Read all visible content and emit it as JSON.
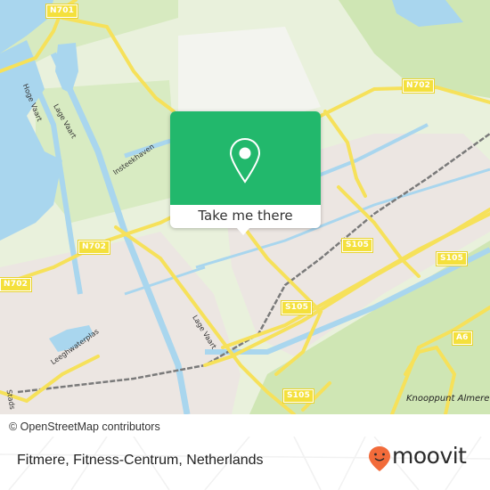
{
  "map": {
    "colors": {
      "water": "#a9d6ee",
      "park": "#cfe6b4",
      "urban": "#ece6e2",
      "road_major": "#f6e15a",
      "railway": "#7a7a7a",
      "background": "#eef3e4"
    },
    "road_shields": [
      {
        "id": "n701",
        "label": "N701"
      },
      {
        "id": "n702-east",
        "label": "N702"
      },
      {
        "id": "n702-center",
        "label": "N702"
      },
      {
        "id": "n702-west",
        "label": "N702"
      },
      {
        "id": "s105-north",
        "label": "S105"
      },
      {
        "id": "s105-east",
        "label": "S105"
      },
      {
        "id": "s105-center",
        "label": "S105"
      },
      {
        "id": "s105-south",
        "label": "S105"
      },
      {
        "id": "a6",
        "label": "A6"
      }
    ],
    "street_labels": {
      "hoge_vaart": "Hoge Vaart",
      "lage_vaart_north": "Lage Vaart",
      "lage_vaart_center": "Lage Vaart",
      "insteekhaven": "Insteekhaven",
      "leeghwaterplas": "Leeghwaterplas",
      "stadsweg": "Stads"
    },
    "place_labels": {
      "knooppunt": "Knooppunt Almere"
    },
    "attribution": "© OpenStreetMap contributors"
  },
  "popup": {
    "icon": "location-pin-icon",
    "button_label": "Take me there",
    "color": "#22b86c"
  },
  "footer": {
    "title": "Fitmere, Fitness-Centrum, Netherlands",
    "brand": "moovit",
    "brand_color": "#f26b3a"
  }
}
